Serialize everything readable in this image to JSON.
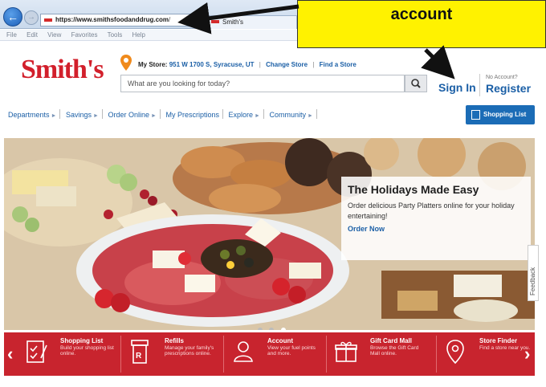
{
  "browser": {
    "url_host": "https://www.smithsfoodanddrug.com",
    "url_rest": "/",
    "tab_title": "Smith's",
    "menu": [
      "File",
      "Edit",
      "View",
      "Favorites",
      "Tools",
      "Help"
    ]
  },
  "header": {
    "logo": "Smith's",
    "my_store_label": "My Store:",
    "store_address": "951 W 1700 S, Syracuse, UT",
    "change_store": "Change Store",
    "find_store": "Find a Store",
    "search_placeholder": "What are you looking for today?",
    "sign_in": "Sign In",
    "no_account": "No Account?",
    "register": "Register"
  },
  "nav": {
    "items": [
      "Departments",
      "Savings",
      "Order Online",
      "My Prescriptions",
      "Explore",
      "Community"
    ],
    "shopping_list": "Shopping List"
  },
  "hero": {
    "title": "The Holidays Made Easy",
    "text": "Order delicious Party Platters online for your holiday entertaining!",
    "link": "Order Now"
  },
  "feedback": "Feedback",
  "quick_links": [
    {
      "title": "Shopping List",
      "desc": "Build your shopping list online."
    },
    {
      "title": "Refills",
      "desc": "Manage your family's prescriptions online."
    },
    {
      "title": "Account",
      "desc": "View your fuel points and more."
    },
    {
      "title": "Gift Card Mall",
      "desc": "Browse the Gift Card Mall online."
    },
    {
      "title": "Store Finder",
      "desc": "Find a store near you."
    }
  ],
  "annotation": {
    "callout_text": "account"
  },
  "colors": {
    "brand_red": "#d21f2b",
    "link_blue": "#1b5fa6",
    "callout_yellow": "#fff200"
  }
}
